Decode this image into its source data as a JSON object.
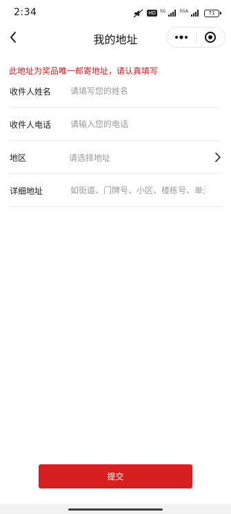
{
  "status_bar": {
    "time": "2:34",
    "network_1": "5G",
    "network_2": "5GA",
    "hd_label": "HD",
    "battery": "71"
  },
  "nav": {
    "title": "我的地址"
  },
  "notice": "此地址为奖品唯一邮寄地址，请认真填写",
  "form": {
    "name": {
      "label": "收件人姓名",
      "placeholder": "请填写您的姓名"
    },
    "phone": {
      "label": "收件人电话",
      "placeholder": "请输入您的电话"
    },
    "region": {
      "label": "地区",
      "placeholder": "请选择地址"
    },
    "address": {
      "label": "详细地址",
      "placeholder": "如街道、门牌号、小区、楼栋号、单元"
    }
  },
  "submit_label": "提交",
  "colors": {
    "accent": "#d61f1f",
    "notice": "#d11d1d",
    "placeholder": "#9a9a9a"
  },
  "icons": [
    "back-arrow-icon",
    "more-dots-icon",
    "target-circle-icon",
    "chevron-right-icon",
    "signal-icon",
    "battery-icon"
  ]
}
